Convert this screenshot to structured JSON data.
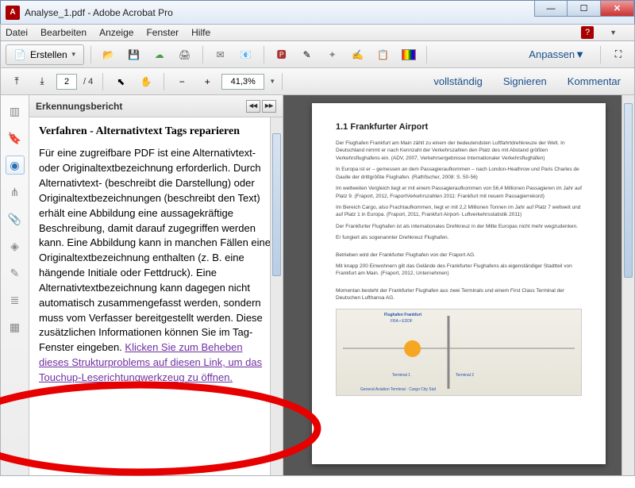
{
  "window": {
    "title": "Analyse_1.pdf - Adobe Acrobat Pro"
  },
  "menu": {
    "file": "Datei",
    "edit": "Bearbeiten",
    "view": "Anzeige",
    "window": "Fenster",
    "help": "Hilfe"
  },
  "toolbar": {
    "create": "Erstellen",
    "customize": "Anpassen",
    "page_current": "2",
    "page_total": "/ 4",
    "zoom": "41,3%",
    "full": "vollständig",
    "sign": "Signieren",
    "comment": "Kommentar"
  },
  "panel": {
    "header": "Erkennungsbericht",
    "heading": "Verfahren - Alternativtext Tags reparieren",
    "body": "Für eine zugreifbare PDF ist eine Alternativtext- oder Originaltextbezeichnung erforderlich. Durch Alternativtext- (beschreibt die Darstellung) oder Originaltextbezeichnungen (beschreibt den Text) erhält eine Abbildung eine aussagekräftige Beschreibung, damit darauf zugegriffen werden kann. Eine Abbildung kann in manchen Fällen eine Originaltextbezeichnung enthalten (z. B. eine hängende Initiale oder Fettdruck). Eine Alternativtextbezeichnung kann dagegen nicht automatisch zusammengefasst werden, sondern muss vom Verfasser bereitgestellt werden. Diese zusätzlichen Informationen können Sie im Tag-Fenster eingeben. ",
    "link": "Klicken Sie zum Beheben dieses Strukturproblems auf diesen Link, um das Touchup-Leserichtungwerkzeug zu öffnen."
  },
  "document": {
    "heading": "1.1 Frankfurter Airport",
    "p1": "Der Flughafen Frankfurt am Main zählt zu einem der bedeutendsten Luftfahrtdrehkreuze der Welt. In Deutschland nimmt er nach Kennzahl der Verkehrszahlen den Platz des mit Abstand größten Verkehrsflughafens ein. (ADV, 2007, Verkehrsergebnisse Internationaler Verkehrsflughäfen)",
    "p2": "In Europa ist er – gemessen an dem Passagieraufkommen – nach London-Heathrow und Paris Charles de Gaulle der drittgrößte Flughafen. (Rathfischer, 2008: S. 50-56)",
    "p3": "Im weltweiten Vergleich liegt er mit einem Passagieraufkommen von 56,4 Millionen Passagieren im Jahr auf Platz 9. (Fraport, 2012, FraportVerkehrszahlen 2011: Frankfurt mit neuem Passagierrekord)",
    "p4": "Im Bereich Cargo, also Frachtaufkommen, liegt er mit 2,2 Millionen Tonnen im Jahr auf Platz 7 weltweit und auf Platz 1 in Europa. (Fraport, 2011, Frankfurt Airport- Luftverkehrsstatistik 2011)",
    "p5": "Der Frankfurter Flughafen ist als internationales Drehkreuz in der Mitte Europas nicht mehr wegzudenken.",
    "p6": "Er fungiert als sogenannter Drehkreuz Flughafen.",
    "p7": "Betrieben wird der Frankfurter Flughafen von der Fraport AG.",
    "p8": "Mit knapp 200 Einwohnern gilt das Gelände des Frankfurter Flughafens als eigenständiger Stadtteil von Frankfurt am Main. (Fraport, 2012, Unternehmen)",
    "p9": "Momentan besteht der Frankfurter Flughafen aus zwei Terminals und einem First Class Terminal der Deutschen Lufthansa AG.",
    "map_l1": "Flughafen Frankfurt",
    "map_l2": "FRA • EDDF",
    "map_t1": "Terminal 1",
    "map_t2": "Terminal 2",
    "map_b": "General Aviation Terminal · Cargo City Süd"
  }
}
